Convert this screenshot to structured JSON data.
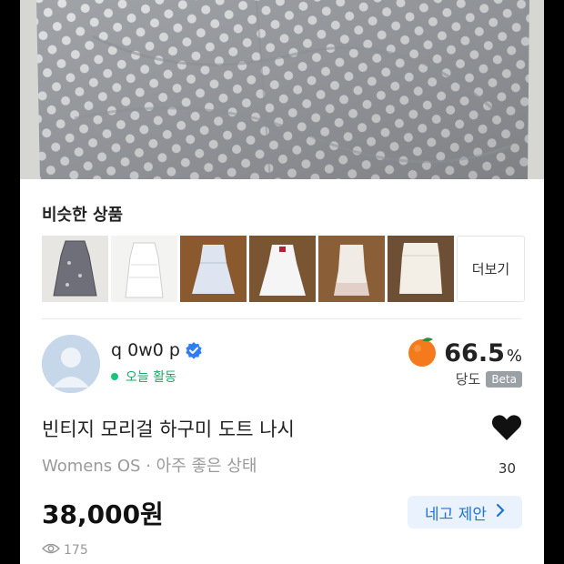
{
  "similar": {
    "title": "비슷한 상품",
    "more_label": "더보기"
  },
  "seller": {
    "name": "q 0w0 p",
    "status": "오늘 활동",
    "sweetness_value": "66.5",
    "sweetness_unit": "%",
    "sweetness_label": "당도",
    "beta": "Beta"
  },
  "product": {
    "title": "빈티지 모리걸 하구미 도트 나시",
    "meta": "Womens OS · 아주 좋은 상태",
    "likes": "30",
    "price": "38,000원",
    "offer_label": "네고 제안",
    "views": "175"
  },
  "colors": {
    "accent": "#1e73d6",
    "offer_bg": "#eaf3fd",
    "active_green": "#1aa96a"
  },
  "icons": [
    "verified-check-icon",
    "tangerine-icon",
    "heart-icon",
    "chevron-right-icon",
    "eye-icon"
  ]
}
